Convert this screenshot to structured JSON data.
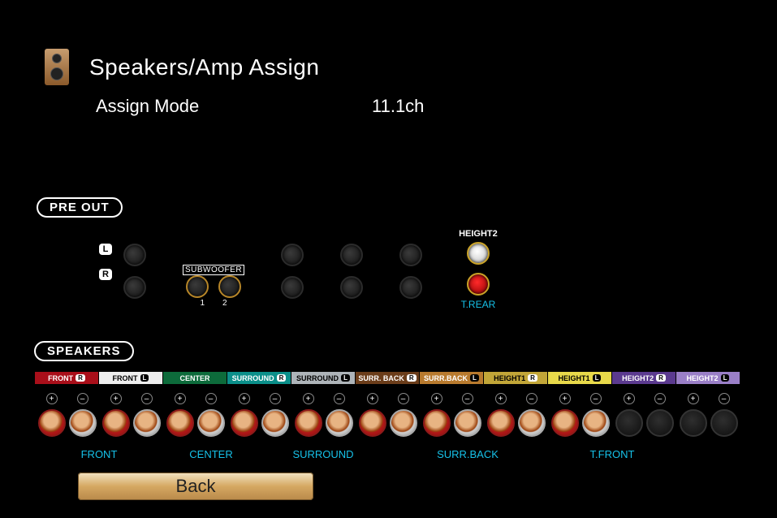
{
  "header": {
    "title": "Speakers/Amp Assign"
  },
  "assign": {
    "label": "Assign Mode",
    "value": "11.1ch"
  },
  "sections": {
    "preout_title": "PRE OUT",
    "speakers_title": "SPEAKERS"
  },
  "preout": {
    "left_label": "L",
    "right_label": "R",
    "subwoofer_label": "SUBWOOFER",
    "sub1": "1",
    "sub2": "2",
    "height2_label": "HEIGHT2",
    "trear_label": "T.REAR"
  },
  "terminals": [
    {
      "label": "FRONT",
      "ch": "R",
      "class": "red",
      "ch_inv": false,
      "active": true
    },
    {
      "label": "FRONT",
      "ch": "L",
      "class": "white",
      "ch_inv": true,
      "active": true
    },
    {
      "label": "CENTER",
      "ch": "",
      "class": "green",
      "ch_inv": false,
      "active": true
    },
    {
      "label": "SURROUND",
      "ch": "R",
      "class": "teal",
      "ch_inv": false,
      "active": true
    },
    {
      "label": "SURROUND",
      "ch": "L",
      "class": "grey",
      "ch_inv": true,
      "active": true
    },
    {
      "label": "SURR. BACK",
      "ch": "R",
      "class": "brown",
      "ch_inv": false,
      "active": true
    },
    {
      "label": "SURR.BACK",
      "ch": "L",
      "class": "tan",
      "ch_inv": true,
      "active": true
    },
    {
      "label": "HEIGHT1",
      "ch": "R",
      "class": "gold",
      "ch_inv": false,
      "active": true
    },
    {
      "label": "HEIGHT1",
      "ch": "L",
      "class": "yellow",
      "ch_inv": true,
      "active": true
    },
    {
      "label": "HEIGHT2",
      "ch": "R",
      "class": "purple",
      "ch_inv": false,
      "active": false
    },
    {
      "label": "HEIGHT2",
      "ch": "L",
      "class": "lav",
      "ch_inv": true,
      "active": false
    }
  ],
  "bottom_labels": [
    "FRONT",
    "CENTER",
    "SURROUND",
    "SURR.BACK",
    "T.FRONT"
  ],
  "pm": {
    "plus": "+",
    "minus": "–"
  },
  "buttons": {
    "back": "Back"
  }
}
